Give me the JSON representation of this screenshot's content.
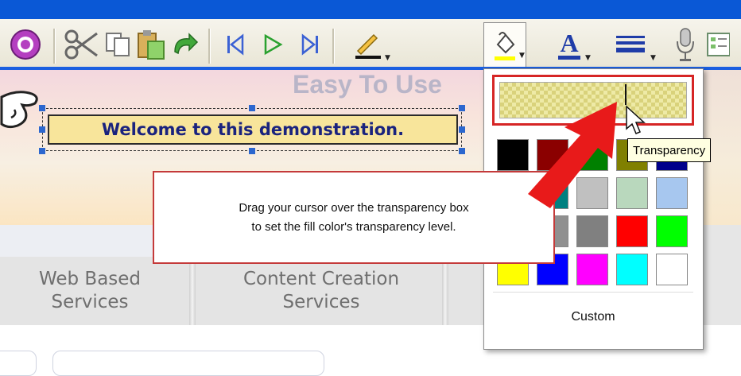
{
  "toolbar": {
    "icons": [
      "eraser-icon",
      "cut-icon",
      "copy-icon",
      "paste-icon",
      "undo-icon",
      "first-frame-icon",
      "play-icon",
      "last-frame-icon",
      "line-color-icon",
      "fill-color-icon",
      "font-color-icon",
      "line-style-icon",
      "audio-icon",
      "properties-icon"
    ]
  },
  "banner": {
    "text": "Easy To Use"
  },
  "welcome": {
    "text": "Welcome to this demonstration."
  },
  "callout": {
    "line1": "Drag your cursor over the transparency box",
    "line2": "to set the fill color's transparency level."
  },
  "nav": {
    "items": [
      {
        "line1": "Web Based",
        "line2": "Services"
      },
      {
        "line1": "Content Creation",
        "line2": "Services"
      }
    ]
  },
  "palette": {
    "tooltip": "Transparency",
    "custom_label": "Custom",
    "colors": [
      [
        "#000000",
        "#8b0000",
        "#008000",
        "#808000",
        "#00008b"
      ],
      [
        "#2f4f4f",
        "#008080",
        "#c0c0c0",
        "#b9d8bd",
        "#a7c7ef"
      ],
      [
        "#505050",
        "#909090",
        "#808080",
        "#ff0000",
        "#00ff00"
      ],
      [
        "#ffff00",
        "#0000ff",
        "#ff00ff",
        "#00ffff",
        "#ffffff"
      ]
    ]
  },
  "colors": {
    "accent": "#1a5fe0",
    "callout_border": "#c43a3a",
    "arrow": "#e81a1a"
  }
}
